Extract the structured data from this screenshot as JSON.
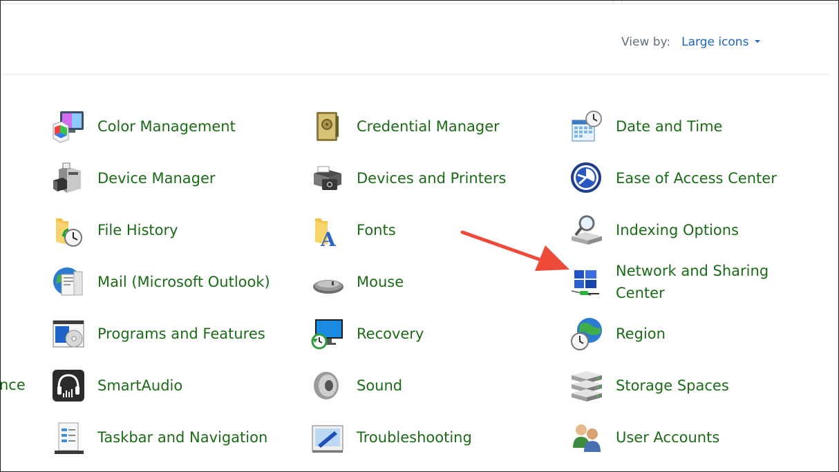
{
  "header": {
    "view_by_label": "View by:",
    "view_by_value": "Large icons"
  },
  "clipped_item": {
    "label": "nce"
  },
  "colors": {
    "item_text": "#1a6b16",
    "link_text": "#1a63c2",
    "label_text": "#5e6f7e",
    "annotation_arrow": "#ee4a3a"
  },
  "items": [
    {
      "label": "Color Management",
      "icon": "color-management-icon"
    },
    {
      "label": "Credential Manager",
      "icon": "credential-manager-icon"
    },
    {
      "label": "Date and Time",
      "icon": "date-and-time-icon"
    },
    {
      "label": "Device Manager",
      "icon": "device-manager-icon"
    },
    {
      "label": "Devices and Printers",
      "icon": "devices-and-printers-icon"
    },
    {
      "label": "Ease of Access Center",
      "icon": "ease-of-access-icon"
    },
    {
      "label": "File History",
      "icon": "file-history-icon"
    },
    {
      "label": "Fonts",
      "icon": "fonts-icon"
    },
    {
      "label": "Indexing Options",
      "icon": "indexing-options-icon"
    },
    {
      "label": "Mail (Microsoft Outlook)",
      "icon": "mail-icon"
    },
    {
      "label": "Mouse",
      "icon": "mouse-icon"
    },
    {
      "label": "Network and Sharing Center",
      "icon": "network-sharing-icon"
    },
    {
      "label": "Programs and Features",
      "icon": "programs-features-icon"
    },
    {
      "label": "Recovery",
      "icon": "recovery-icon"
    },
    {
      "label": "Region",
      "icon": "region-icon"
    },
    {
      "label": "SmartAudio",
      "icon": "smartaudio-icon"
    },
    {
      "label": "Sound",
      "icon": "sound-icon"
    },
    {
      "label": "Storage Spaces",
      "icon": "storage-spaces-icon"
    },
    {
      "label": "Taskbar and Navigation",
      "icon": "taskbar-navigation-icon"
    },
    {
      "label": "Troubleshooting",
      "icon": "troubleshooting-icon"
    },
    {
      "label": "User Accounts",
      "icon": "user-accounts-icon"
    }
  ]
}
